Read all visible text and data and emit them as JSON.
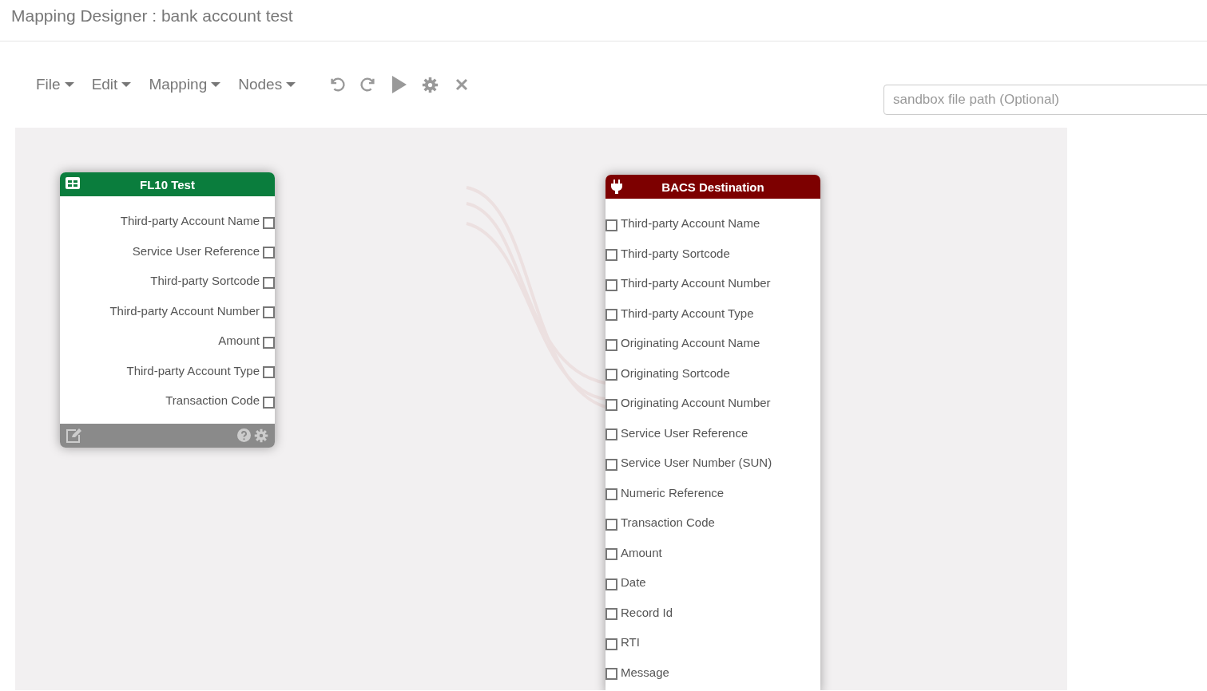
{
  "window": {
    "title": "Mapping Designer : bank account test"
  },
  "menus": [
    {
      "label": "File"
    },
    {
      "label": "Edit"
    },
    {
      "label": "Mapping"
    },
    {
      "label": "Nodes"
    }
  ],
  "toolbar": [
    {
      "kind": "undo"
    },
    {
      "kind": "redo"
    },
    {
      "kind": "run"
    },
    {
      "kind": "settings"
    },
    {
      "kind": "close"
    }
  ],
  "sandbox_path": {
    "placeholder": "sandbox file path (Optional)"
  },
  "nodes": [
    {
      "kind": "source",
      "title": "FL10 Test",
      "color": "#0a7d3d",
      "fields": [
        "Third-party Account Name",
        "Service User Reference",
        "Third-party Sortcode",
        "Third-party Account Number",
        "Amount",
        "Third-party Account Type",
        "Transaction Code"
      ]
    },
    {
      "kind": "destination",
      "title": "BACS Destination",
      "color": "#7d0000",
      "fields": [
        "Third-party Account Name",
        "Third-party Sortcode",
        "Third-party Account Number",
        "Third-party Account Type",
        "Originating Account Name",
        "Originating Sortcode",
        "Originating Account Number",
        "Service User Reference",
        "Service User Number (SUN)",
        "Numeric Reference",
        "Transaction Code",
        "Amount",
        "Date",
        "Record Id",
        "RTI",
        "Message"
      ]
    }
  ]
}
